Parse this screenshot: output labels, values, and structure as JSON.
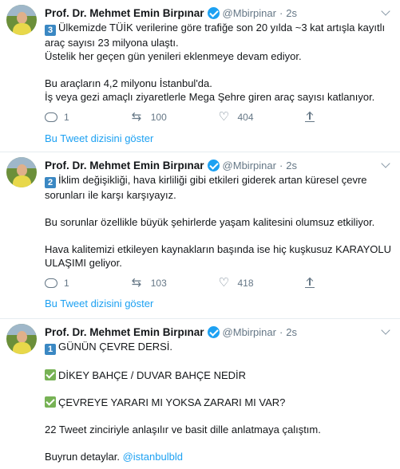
{
  "tweets": [
    {
      "name": "Prof. Dr. Mehmet Emin Birpınar",
      "handle": "@Mbirpinar",
      "time": "2s",
      "badge": "3",
      "lines": [
        "Ülkemizde TÜİK verilerine göre trafiğe son 20 yılda ~3 kat artışla kayıtlı araç sayısı 23 milyona ulaştı.",
        "Üstelik her geçen gün yenileri eklenmeye devam ediyor.",
        "",
        "Bu araçların 4,2 milyonu İstanbul'da.",
        "İş veya gezi amaçlı ziyaretlerle Mega Şehre giren araç sayısı katlanıyor."
      ],
      "replies": "1",
      "retweets": "100",
      "likes": "404",
      "thread_link": "Bu Tweet dizisini göster"
    },
    {
      "name": "Prof. Dr. Mehmet Emin Birpınar",
      "handle": "@Mbirpinar",
      "time": "2s",
      "badge": "2",
      "lines": [
        "İklim değişikliği, hava kirliliği gibi etkileri giderek artan küresel çevre sorunları ile karşı karşıyayız.",
        "",
        "Bu sorunlar özellikle büyük şehirlerde yaşam kalitesini olumsuz etkiliyor.",
        "",
        "Hava kalitemizi etkileyen kaynakların başında ise hiç kuşkusuz KARAYOLU ULAŞIMI geliyor."
      ],
      "replies": "1",
      "retweets": "103",
      "likes": "418",
      "thread_link": "Bu Tweet dizisini göster"
    },
    {
      "name": "Prof. Dr. Mehmet Emin Birpınar",
      "handle": "@Mbirpinar",
      "time": "2s",
      "badge": "1",
      "line1": "GÜNÜN ÇEVRE DERSİ.",
      "item1": "DİKEY BAHÇE / DUVAR BAHÇE NEDİR",
      "item2": "ÇEVREYE YARARI MI YOKSA ZARARI MI VAR?",
      "line2": "22 Tweet zinciriyle anlaşılır ve basit dille anlatmaya çalıştım.",
      "line3": "Buyrun detaylar.",
      "mention": "@istanbulbld"
    }
  ],
  "colors": {
    "accent": "#1da1f2",
    "muted": "#657786",
    "text": "#14171a",
    "badge": "#3b88c3",
    "check": "#77b255"
  }
}
